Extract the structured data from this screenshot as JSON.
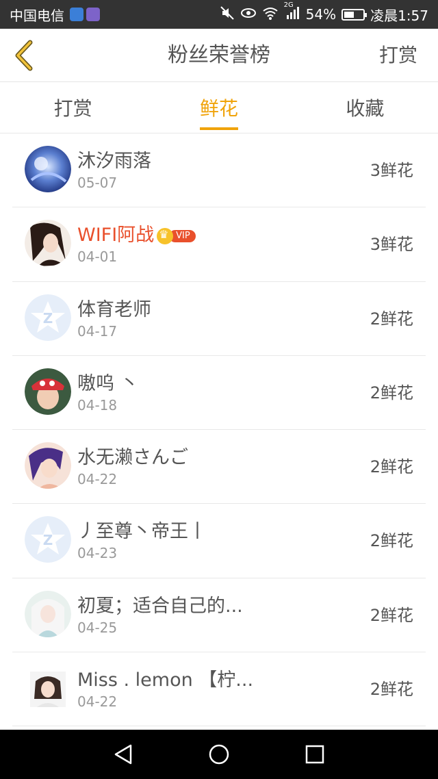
{
  "status_bar": {
    "carrier": "中国电信",
    "network": "2G",
    "battery": "54%",
    "battery_level": 0.54,
    "time": "凌晨1:57"
  },
  "header": {
    "title": "粉丝荣誉榜",
    "action_label": "打赏"
  },
  "tabs": [
    {
      "label": "打赏",
      "active": false
    },
    {
      "label": "鲜花",
      "active": true
    },
    {
      "label": "收藏",
      "active": false
    }
  ],
  "colors": {
    "accent": "#f0a30a",
    "vip_name": "#e9502c",
    "status_bar": "#333333"
  },
  "rows": [
    {
      "name": "沐汐雨落",
      "date": "05-07",
      "count": "3鲜花",
      "avatar": "blue-anime-avatar",
      "vip": false
    },
    {
      "name": "WIFI阿战",
      "date": "04-01",
      "count": "3鲜花",
      "avatar": "long-hair-character-avatar",
      "vip": true,
      "vip_label": "VIP"
    },
    {
      "name": "体育老师",
      "date": "04-17",
      "count": "2鲜花",
      "avatar": "default-star-avatar",
      "vip": false
    },
    {
      "name": "嗷呜 丶",
      "date": "04-18",
      "count": "2鲜花",
      "avatar": "red-hat-boy-avatar",
      "vip": false
    },
    {
      "name": "水无濑さんご",
      "date": "04-22",
      "count": "2鲜花",
      "avatar": "purple-hair-girl-avatar",
      "vip": false
    },
    {
      "name": "丿至尊丶帝王丨",
      "date": "04-23",
      "count": "2鲜花",
      "avatar": "default-star-avatar",
      "vip": false
    },
    {
      "name": "初夏；适合自己的...",
      "date": "04-25",
      "count": "2鲜花",
      "avatar": "white-hair-girl-avatar",
      "vip": false
    },
    {
      "name": "Miss . lemon 【柠...",
      "date": "04-22",
      "count": "2鲜花",
      "avatar": "photo-girl-avatar",
      "vip": false
    }
  ]
}
